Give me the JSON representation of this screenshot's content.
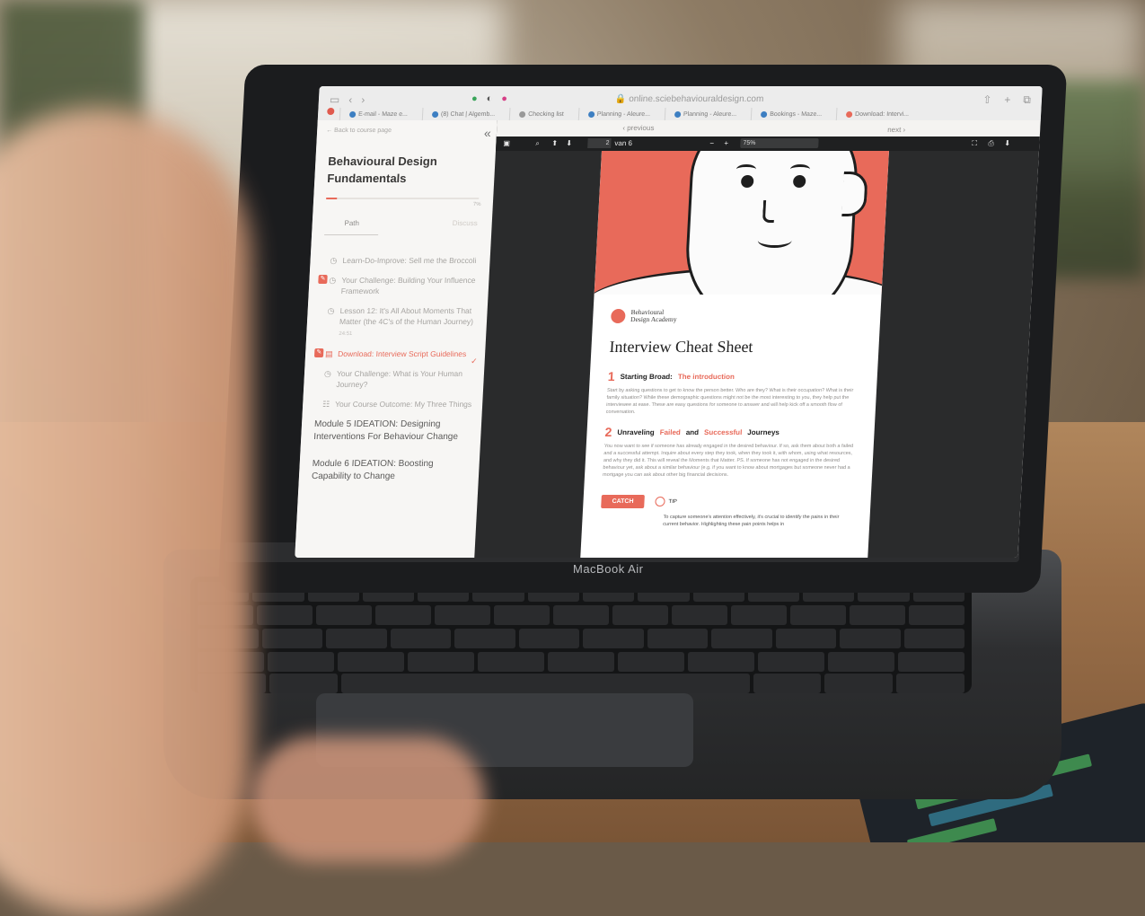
{
  "browser": {
    "url": "online.sciebehaviouraldesign.com",
    "tabs": [
      "E-mail - Maze e...",
      "(8) Chat | Algemb...",
      "Checking list",
      "Planning - Aleure...",
      "Planning - Aleure...",
      "Bookings - Maze...",
      "Download: Intervi..."
    ]
  },
  "sidebar": {
    "back_link": "← Back to course page",
    "course_title": "Behavioural Design Fundamentals",
    "progress_pct": "7%",
    "progress_value": 0.07,
    "tab_path": "Path",
    "tab_discuss": "Discuss",
    "lessons": [
      {
        "title": "Learn-Do-Improve: Sell me the Broccoli",
        "state": "normal"
      },
      {
        "title": "Your Challenge: Building Your Influence Framework",
        "state": "badge"
      },
      {
        "title": "Lesson 12: It's All About Moments That Matter (the 4C's of the Human Journey)",
        "sub": "24:51",
        "state": "normal"
      },
      {
        "title": "Download: Interview Script Guidelines",
        "state": "active"
      },
      {
        "title": "Your Challenge: What is Your Human Journey?",
        "state": "normal"
      },
      {
        "title": "Your Course Outcome: My Three Things",
        "state": "normal"
      }
    ],
    "modules": [
      "Module 5 IDEATION: Designing Interventions For Behaviour Change",
      "Module 6 IDEATION: Boosting Capability to Change"
    ]
  },
  "viewer": {
    "prev_label": "‹ previous",
    "next_label": "next ›",
    "page_current": "2",
    "page_total": "van 6",
    "zoom": "75%"
  },
  "pdf": {
    "logo_line1": "Behavioural",
    "logo_line2": "Design Academy",
    "title": "Interview Cheat Sheet",
    "sections": [
      {
        "num": "1",
        "head_plain": "Starting Broad:",
        "head_accent": "The introduction",
        "text": "Start by asking questions to get to know the person better. Who are they? What is their occupation? What is their family situation? While these demographic questions might not be the most interesting to you, they help put the interviewee at ease. These are easy questions for someone to answer and will help kick off a smooth flow of conversation."
      },
      {
        "num": "2",
        "head_plain": "Unraveling",
        "head_accent": "Failed",
        "head_and": "and",
        "head_accent2": "Successful",
        "head_tail": "Journeys",
        "text": "You now want to see if someone has already engaged in the desired behaviour. If so, ask them about both a failed and a successful attempt. Inquire about every step they took, when they took it, with whom, using what resources, and why they did it. This will reveal the Moments that Matter. PS. If someone has not engaged in the desired behaviour yet, ask about a similar behaviour (e.g. if you want to know about mortgages but someone never had a mortgage you can ask about other big financial decisions."
      }
    ],
    "catch_label": "CATCH",
    "tip_label": "TIP",
    "tip_text": "To capture someone's attention effectively, it's crucial to identify the pains in their current behavior. Highlighting these pain points helps in"
  },
  "device": {
    "brand": "MacBook Air"
  },
  "colors": {
    "accent": "#e86a5a",
    "viewer_dark": "#2a2b2c"
  }
}
